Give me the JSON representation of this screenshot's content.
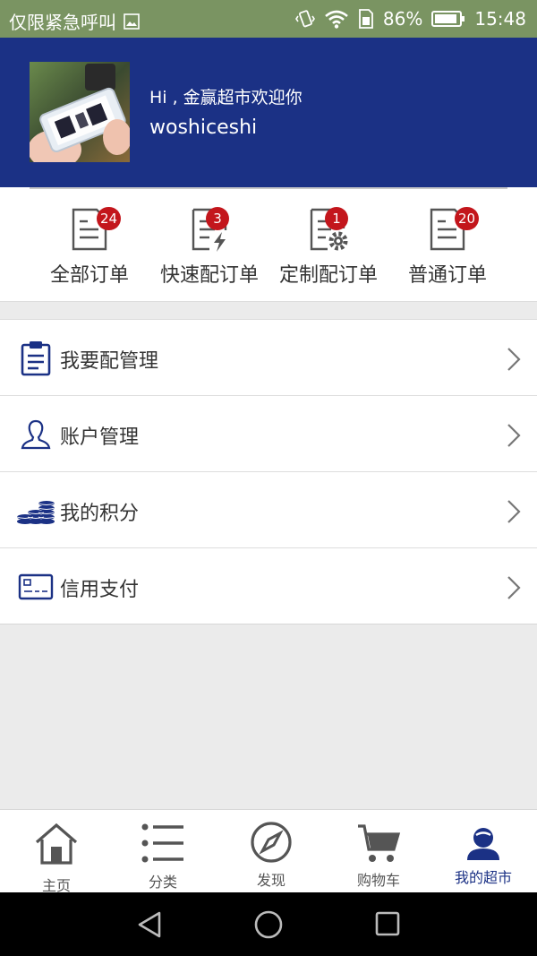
{
  "status_bar": {
    "carrier": "仅限紧急呼叫",
    "battery": "86%",
    "time": "15:48"
  },
  "header": {
    "greeting": "Hi , 金赢超市欢迎你",
    "username": "woshiceshi"
  },
  "orders": [
    {
      "label": "全部订单",
      "badge": "24",
      "icon": "order-all-icon"
    },
    {
      "label": "快速配订单",
      "badge": "3",
      "icon": "order-fast-icon"
    },
    {
      "label": "定制配订单",
      "badge": "1",
      "icon": "order-custom-icon"
    },
    {
      "label": "普通订单",
      "badge": "20",
      "icon": "order-normal-icon"
    }
  ],
  "menu": [
    {
      "label": "我要配管理",
      "icon": "clipboard-icon"
    },
    {
      "label": "账户管理",
      "icon": "user-outline-icon"
    },
    {
      "label": "我的积分",
      "icon": "coins-icon"
    },
    {
      "label": "信用支付",
      "icon": "credit-card-icon"
    }
  ],
  "tabs": [
    {
      "label": "主页",
      "icon": "home-icon"
    },
    {
      "label": "分类",
      "icon": "list-icon"
    },
    {
      "label": "发现",
      "icon": "compass-icon"
    },
    {
      "label": "购物车",
      "icon": "cart-icon"
    },
    {
      "label": "我的超市",
      "icon": "person-icon",
      "active": true
    }
  ],
  "colors": {
    "brand": "#1b3185",
    "badge": "#c3161c",
    "status_bar": "#7a9462"
  }
}
